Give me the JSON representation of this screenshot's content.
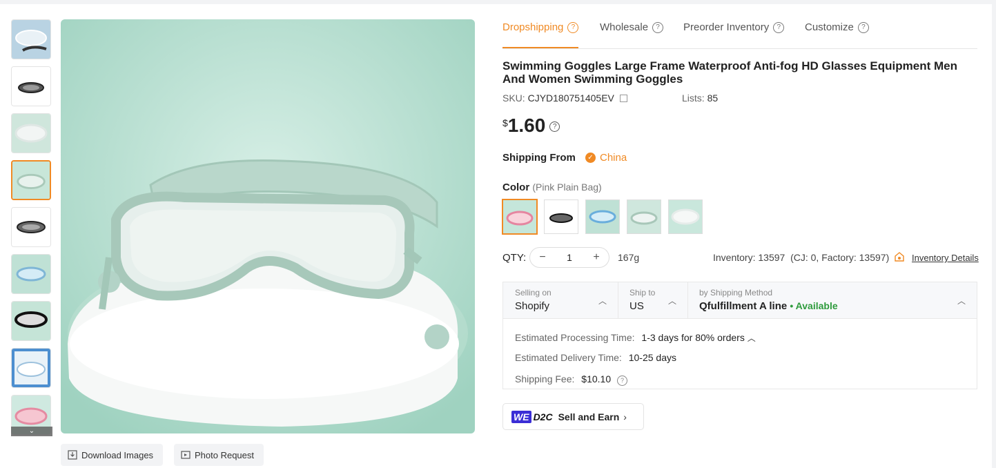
{
  "tabs": [
    {
      "label": "Dropshipping"
    },
    {
      "label": "Wholesale"
    },
    {
      "label": "Preorder Inventory"
    },
    {
      "label": "Customize"
    }
  ],
  "help_glyph": "?",
  "product": {
    "title": "Swimming Goggles Large Frame Waterproof Anti-fog HD Glasses Equipment Men And Women Swimming Goggles",
    "sku_label": "SKU:",
    "sku_value": "CJYD180751405EV",
    "lists_label": "Lists:",
    "lists_value": "85",
    "price_currency": "$",
    "price_value": "1.60"
  },
  "shipping_from": {
    "label": "Shipping From",
    "value": "China"
  },
  "color": {
    "label": "Color",
    "selected": "(Pink Plain Bag)"
  },
  "qty": {
    "label": "QTY:",
    "value": "1",
    "minus": "−",
    "plus": "+",
    "weight": "167g"
  },
  "inventory": {
    "text": "Inventory: 13597  (CJ: 0, Factory: 13597)",
    "details_link": "Inventory Details"
  },
  "shipping": {
    "selling_on_label": "Selling on",
    "selling_on_value": "Shopify",
    "ship_to_label": "Ship to",
    "ship_to_value": "US",
    "method_label": "by Shipping Method",
    "method_value": "Qfulfillment A line",
    "method_status": "• Available",
    "processing_label": "Estimated Processing Time:",
    "processing_value": "1-3 days for 80% orders",
    "delivery_label": "Estimated Delivery Time:",
    "delivery_value": "10-25 days",
    "fee_label": "Shipping Fee:",
    "fee_value": "$10.10"
  },
  "promo": {
    "we": "WE",
    "d2c": "D2C",
    "text": "Sell and Earn",
    "chevron": "›"
  },
  "image_actions": {
    "download": "Download Images",
    "photo_request": "Photo Request"
  },
  "thumb_scroll_icon": "⌄",
  "colors": {
    "accent": "#f08a24",
    "available": "#2e9b3c",
    "brand_we": "#3b2ed6"
  }
}
